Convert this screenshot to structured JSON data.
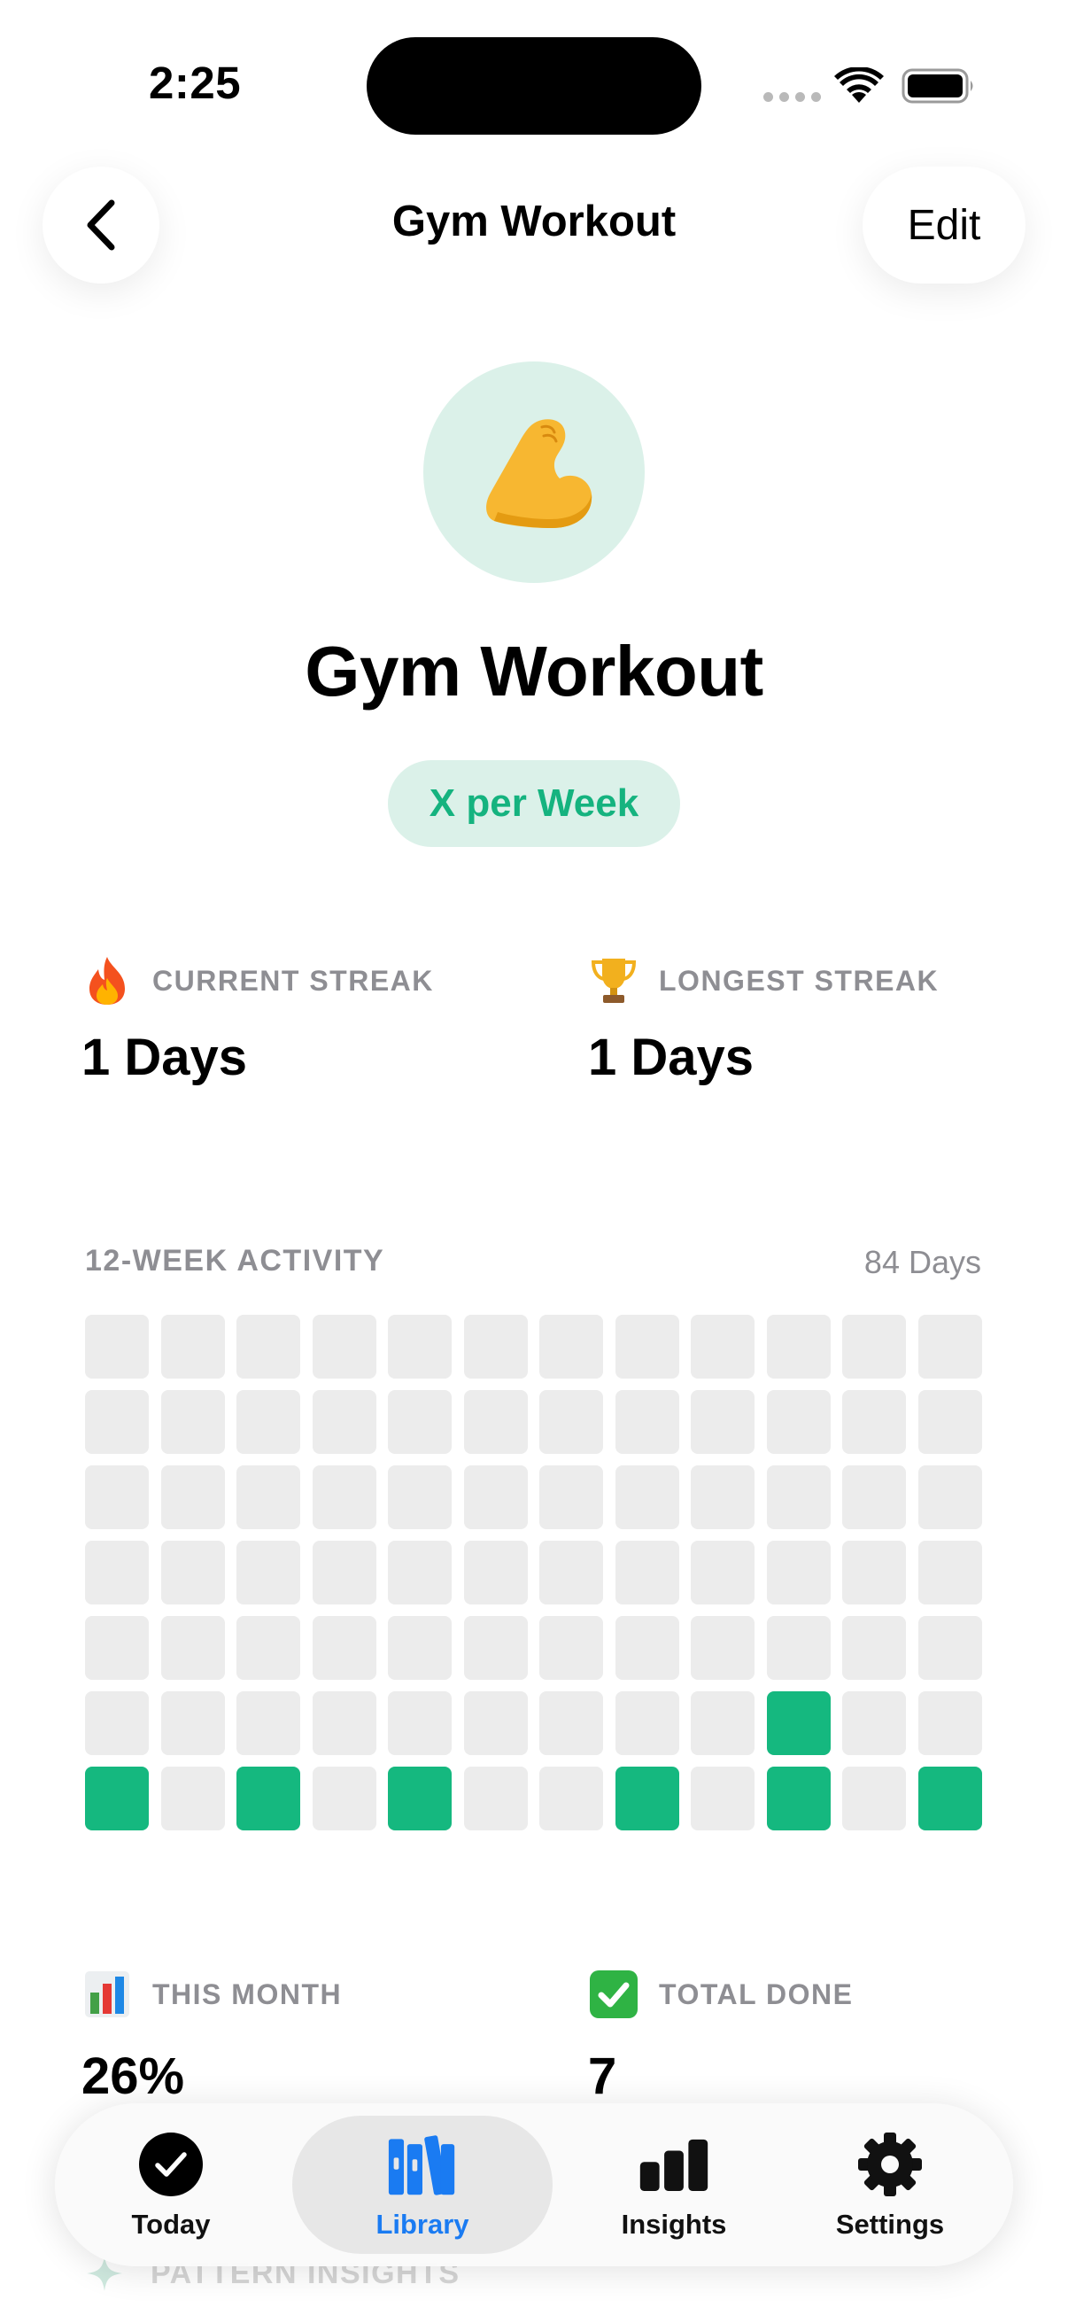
{
  "status_bar": {
    "time": "2:25"
  },
  "nav": {
    "title": "Gym Workout",
    "edit_label": "Edit"
  },
  "habit": {
    "emoji": "💪",
    "name": "Gym Workout",
    "frequency": "X per Week",
    "accent_color": "#15b87f",
    "accent_bg": "#dbf1e9"
  },
  "stats": {
    "current_streak": {
      "icon": "fire-icon",
      "label": "CURRENT STREAK",
      "value": "1 Days"
    },
    "longest_streak": {
      "icon": "trophy-icon",
      "label": "LONGEST STREAK",
      "value": "1 Days"
    }
  },
  "activity": {
    "label": "12-WEEK ACTIVITY",
    "count": "84 Days",
    "weeks": 12,
    "days_per_week": 7,
    "completed": [
      [
        6,
        0
      ],
      [
        6,
        2
      ],
      [
        6,
        4
      ],
      [
        6,
        7
      ],
      [
        6,
        9
      ],
      [
        6,
        11
      ],
      [
        5,
        9
      ]
    ]
  },
  "summary": {
    "this_month": {
      "icon": "bar-chart-icon",
      "label": "THIS MONTH",
      "value": "26%"
    },
    "total_done": {
      "icon": "check-mark-icon",
      "label": "TOTAL DONE",
      "value": "7"
    }
  },
  "pattern_insights": {
    "label": "PATTERN INSIGHTS"
  },
  "tabs": [
    {
      "label": "Today",
      "icon": "checkmark-circle-icon",
      "active": false
    },
    {
      "label": "Library",
      "icon": "books-icon",
      "active": true
    },
    {
      "label": "Insights",
      "icon": "bar-chart-icon",
      "active": false
    },
    {
      "label": "Settings",
      "icon": "gear-icon",
      "active": false
    }
  ],
  "colors": {
    "active_tab": "#1a7bf2",
    "muted_label": "#8e8e93",
    "empty_cell": "#ececec"
  }
}
